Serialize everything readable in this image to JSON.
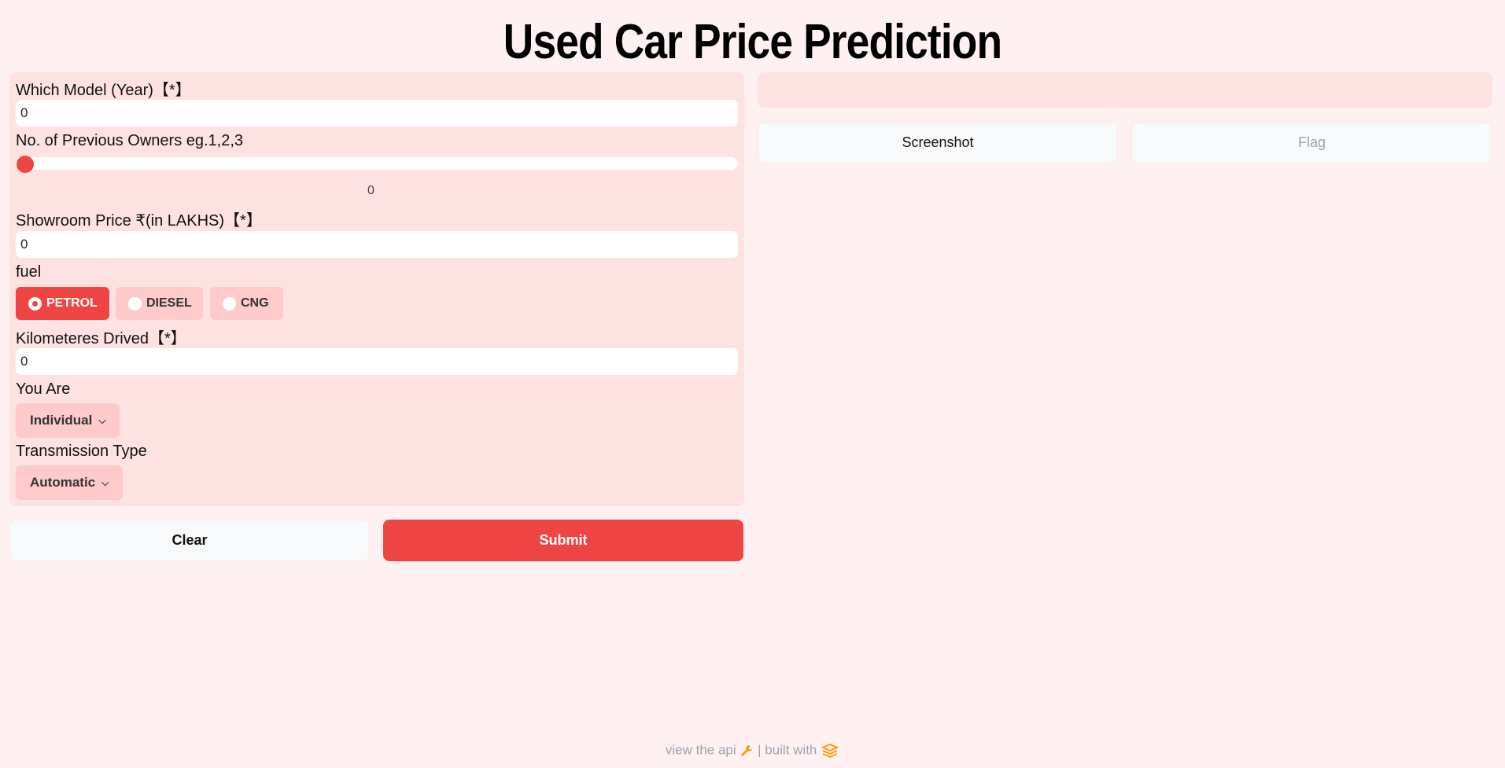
{
  "header": {
    "title": "Used Car Price Prediction"
  },
  "form": {
    "year": {
      "label": "Which Model (Year)【*】",
      "value": "0"
    },
    "owners": {
      "label": "No. of Previous Owners eg.1,2,3",
      "slider_value": "0"
    },
    "price": {
      "label": "Showroom Price ₹(in LAKHS)【*】",
      "value": "0"
    },
    "fuel": {
      "label": "fuel",
      "options": [
        "PETROL",
        "DIESEL",
        "CNG"
      ],
      "selected": "PETROL"
    },
    "km": {
      "label": "Kilometeres Drived【*】",
      "value": "0"
    },
    "seller": {
      "label": "You Are",
      "selected": "Individual"
    },
    "transmission": {
      "label": "Transmission Type",
      "selected": "Automatic"
    }
  },
  "actions": {
    "clear_label": "Clear",
    "submit_label": "Submit"
  },
  "output": {
    "screenshot_label": "Screenshot",
    "flag_label": "Flag"
  },
  "footer": {
    "api_text": "view the api",
    "built_text": "| built with"
  },
  "colors": {
    "accent": "#ef4444",
    "panel": "#fee2e2",
    "background": "#fff1f1"
  },
  "icons": [
    "wrench-icon",
    "gradio-logo-icon",
    "chevron-down-icon"
  ]
}
